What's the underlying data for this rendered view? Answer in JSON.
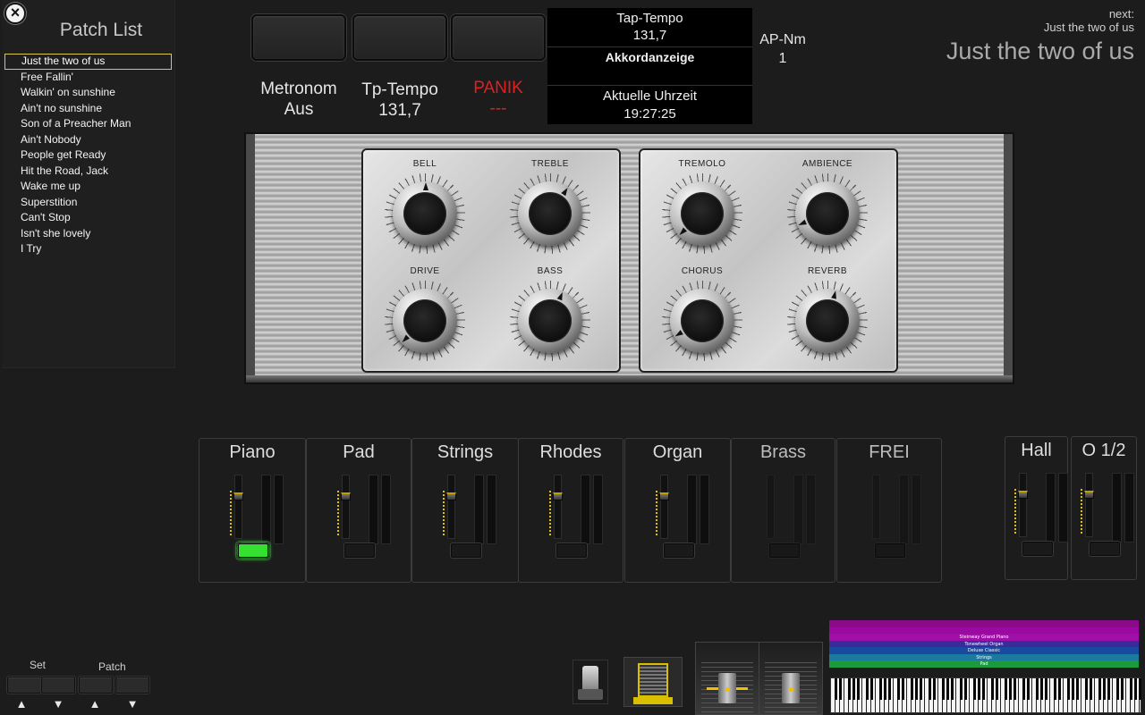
{
  "sidebar": {
    "close_icon": "×",
    "title": "Patch List",
    "patches": [
      "Just the two of us",
      "Free Fallin'",
      "Walkin' on sunshine",
      "Ain't no sunshine",
      "Son of a Preacher Man",
      "Ain't Nobody",
      "People get Ready",
      "Hit the Road, Jack",
      "Wake me up",
      "Superstition",
      "Can't Stop",
      "Isn't she lovely",
      "I Try"
    ],
    "selected_index": 0,
    "set_label": "Set",
    "patch_label": "Patch",
    "arrow_up": "▲",
    "arrow_down": "▼"
  },
  "top": {
    "metronom_label": "Metronom",
    "metronom_value": "Aus",
    "tptempo_label": "Tp-Tempo",
    "tptempo_value": "131,7",
    "panik_label": "PANIK",
    "panik_value": "---",
    "center": {
      "tap_label": "Tap-Tempo",
      "tap_value": "131,7",
      "chord_label": "Akkordanzeige",
      "time_label": "Aktuelle Uhrzeit",
      "time_value": "19:27:25"
    },
    "apnm_label": "AP-Nm",
    "apnm_value": "1",
    "next_label": "next:",
    "next_small": "Just the two of us",
    "current_patch": "Just the two of us"
  },
  "amp": {
    "knobs": [
      {
        "label": "BELL",
        "value": 0.5
      },
      {
        "label": "TREBLE",
        "value": 0.62
      },
      {
        "label": "TREMOLO",
        "value": 0.0
      },
      {
        "label": "AMBIENCE",
        "value": 0.08
      },
      {
        "label": "DRIVE",
        "value": 0.0
      },
      {
        "label": "BASS",
        "value": 0.58
      },
      {
        "label": "CHORUS",
        "value": 0.05
      },
      {
        "label": "REVERB",
        "value": 0.55
      }
    ]
  },
  "channels": [
    {
      "name": "Piano",
      "active": true,
      "enabled": true
    },
    {
      "name": "Pad",
      "active": false,
      "enabled": true
    },
    {
      "name": "Strings",
      "active": false,
      "enabled": true
    },
    {
      "name": "Rhodes",
      "active": false,
      "enabled": true
    },
    {
      "name": "Organ",
      "active": false,
      "enabled": true
    },
    {
      "name": "Brass",
      "active": false,
      "enabled": false
    },
    {
      "name": "FREI",
      "active": false,
      "enabled": false
    },
    {
      "name": "Hall",
      "active": false,
      "enabled": true
    },
    {
      "name": "O 1/2",
      "active": false,
      "enabled": true
    }
  ],
  "layers": [
    {
      "label": "",
      "color": "#8a0a8a"
    },
    {
      "label": "",
      "color": "#9a0aa0"
    },
    {
      "label": "Steinway Grand Piano",
      "color": "#a010a8"
    },
    {
      "label": "Tonewheel Organ",
      "color": "#3a2a9a"
    },
    {
      "label": "Deluxe Classic",
      "color": "#1a4aa0"
    },
    {
      "label": "Strings",
      "color": "#1a7aa0"
    },
    {
      "label": "Pad",
      "color": "#1a9a3a"
    }
  ]
}
